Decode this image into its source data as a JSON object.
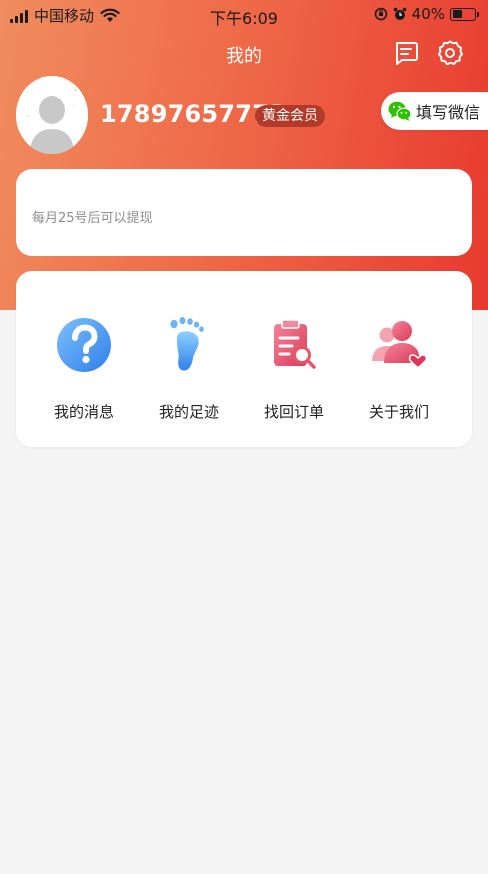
{
  "status_bar": {
    "carrier": "中国移动",
    "time": "下午6:09",
    "battery": "40%",
    "battery_level": 0.4
  },
  "nav": {
    "title": "我的",
    "icons": [
      "message-icon",
      "settings-icon"
    ]
  },
  "profile": {
    "phone": "17897657773",
    "member_level": "黄金会员",
    "wechat_button": "填写微信"
  },
  "withdraw": {
    "notice": "每月25号后可以提现"
  },
  "menu": {
    "items": [
      {
        "label": "我的消息",
        "icon": "question-icon"
      },
      {
        "label": "我的足迹",
        "icon": "footprint-icon"
      },
      {
        "label": "找回订单",
        "icon": "order-search-icon"
      },
      {
        "label": "关于我们",
        "icon": "about-us-icon"
      }
    ]
  },
  "colors": {
    "header_start": "#f08c5e",
    "header_end": "#e8392f",
    "badge": "#b23a2a",
    "wechat_green": "#2dc100",
    "blue_icon": "#3d8ff0",
    "pink_icon": "#e9546b"
  }
}
